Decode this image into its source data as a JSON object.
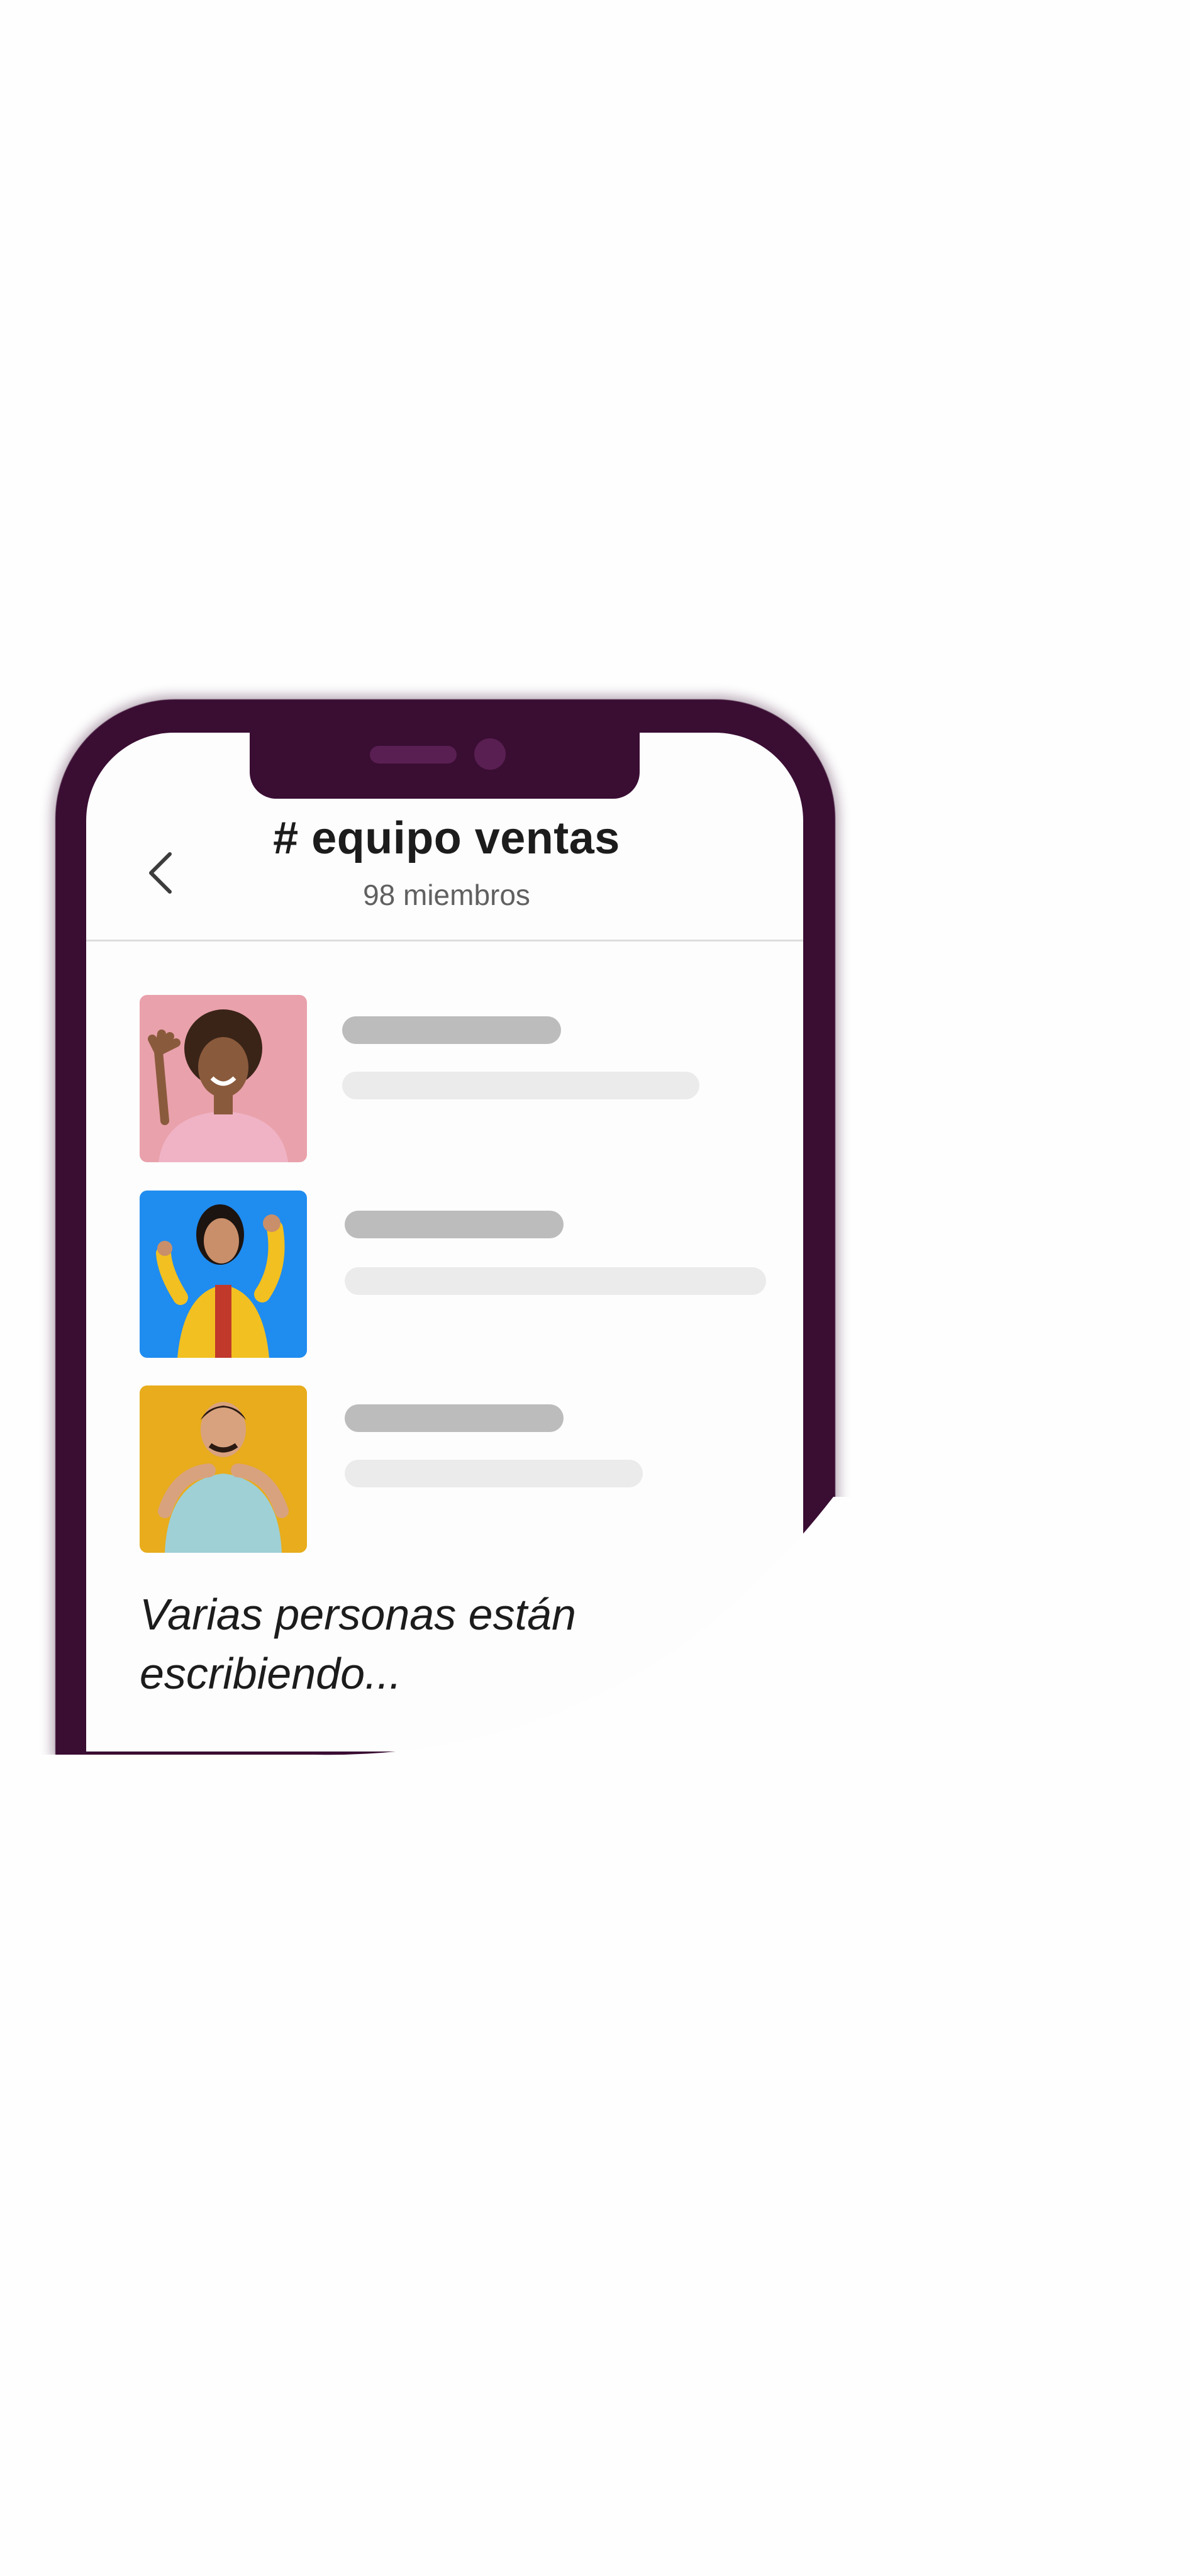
{
  "channel": {
    "title": "# equipo ventas",
    "members": "98 miembros"
  },
  "icons": {
    "back": "chevron-left-icon"
  },
  "messages": [
    {
      "avatar_bg": "#e9a1ab",
      "shirt": "#f0b3c6",
      "skin": "#8a5a3c",
      "hair": "#3a2418"
    },
    {
      "avatar_bg": "#1f8cf0",
      "shirt": "#f2c020",
      "skin": "#c98f6a",
      "hair": "#1c1410"
    },
    {
      "avatar_bg": "#e8ac1c",
      "shirt": "#9ed0d6",
      "skin": "#d9a27e",
      "hair": "#2a1a12"
    }
  ],
  "status": {
    "typing": "Varias personas están escribiendo..."
  },
  "colors": {
    "frame": "#3a0d33",
    "skeleton_name": "#bcbcbc",
    "skeleton_text": "#ebebeb"
  }
}
